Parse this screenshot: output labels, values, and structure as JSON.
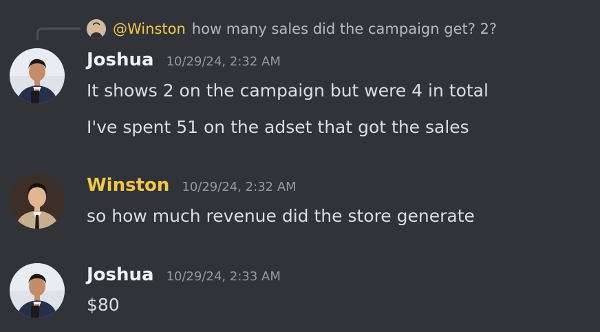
{
  "reply": {
    "mention": "@Winston",
    "text": "how many sales did the campaign get? 2?"
  },
  "messages": [
    {
      "username": "Joshua",
      "timestamp": "10/29/24, 2:32 AM",
      "lines": [
        "It shows 2 on the campaign but were 4 in total",
        "I've spent 51 on the adset that got the sales"
      ]
    },
    {
      "username": "Winston",
      "timestamp": "10/29/24, 2:32 AM",
      "lines": [
        "so how much revenue did the store generate"
      ]
    },
    {
      "username": "Joshua",
      "timestamp": "10/29/24, 2:33 AM",
      "lines": [
        "$80"
      ]
    }
  ],
  "colors": {
    "background": "#323339",
    "winston_name": "#f0c846",
    "text": "#dbdee1",
    "timestamp": "#949ba4"
  }
}
